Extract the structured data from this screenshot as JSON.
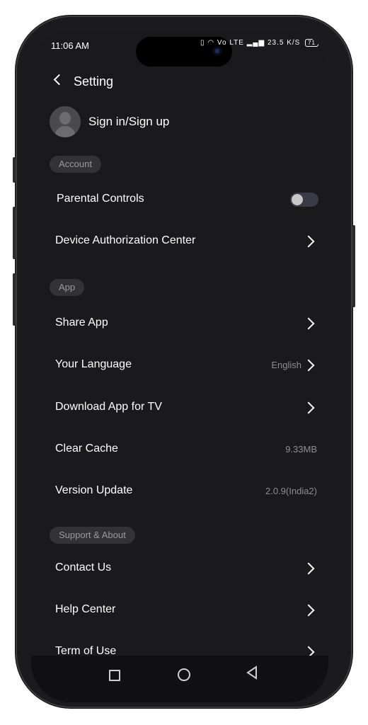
{
  "status_bar": {
    "time": "11:06 AM",
    "network": "Vo LTE",
    "speed": "23.5 K/S",
    "battery": "71"
  },
  "header": {
    "title": "Setting"
  },
  "account_entry": {
    "label": "Sign in/Sign up"
  },
  "sections": {
    "account": "Account",
    "app": "App",
    "support": "Support & About"
  },
  "rows": {
    "parental_controls": {
      "label": "Parental Controls",
      "enabled": false
    },
    "device_auth": {
      "label": "Device Authorization Center"
    },
    "share_app": {
      "label": "Share App"
    },
    "language": {
      "label": "Your Language",
      "value": "English"
    },
    "download_tv": {
      "label": "Download App for TV"
    },
    "clear_cache": {
      "label": "Clear Cache",
      "value": "9.33MB"
    },
    "version_update": {
      "label": "Version Update",
      "value": "2.0.9(India2)"
    },
    "contact_us": {
      "label": "Contact Us"
    },
    "help_center": {
      "label": "Help Center"
    },
    "term_of_use": {
      "label": "Term of Use"
    }
  },
  "icons": {
    "back": "chevron-left-icon",
    "row_chevron": "chevron-right-icon",
    "avatar": "user-avatar-icon",
    "nav": [
      "recents-square-icon",
      "home-circle-icon",
      "back-triangle-icon"
    ]
  },
  "colors": {
    "background": "#1a1a1c",
    "tag_bg": "#333335",
    "toggle_off": "#3b3b48"
  }
}
